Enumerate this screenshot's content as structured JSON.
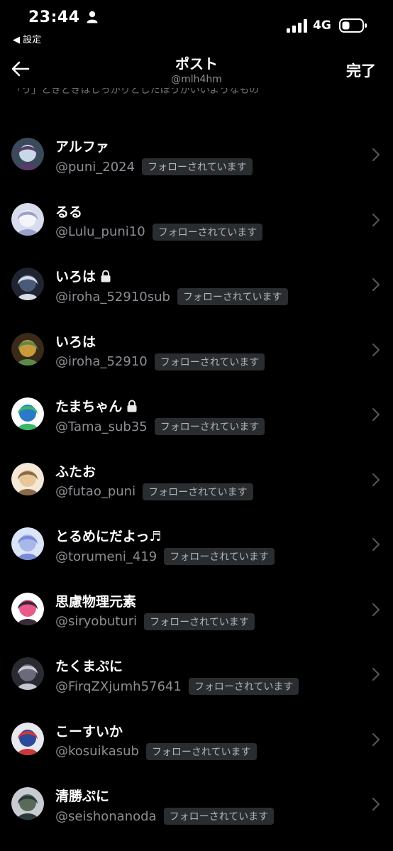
{
  "status_bar": {
    "time": "23:44",
    "back_app": "◀ 設定",
    "network": "4G"
  },
  "nav": {
    "title": "ポスト",
    "subtitle": "@mlh4hm",
    "done_label": "完了"
  },
  "cut_text": "「う」ときどきはしっかりとしたほうがいいようなもの",
  "badge_label": "フォローされています",
  "users": [
    {
      "name": "アルファ",
      "handle": "@puni_2024",
      "locked": false,
      "avatar_colors": [
        "#3a4a5a",
        "#c8d8e8",
        "#5a3a6a"
      ]
    },
    {
      "name": "るる",
      "handle": "@Lulu_puni10",
      "locked": false,
      "avatar_colors": [
        "#d8dcec",
        "#f4f4fa",
        "#9aa0c8"
      ]
    },
    {
      "name": "いろは",
      "handle": "@iroha_52910sub",
      "locked": true,
      "avatar_colors": [
        "#1e2430",
        "#4a5a7a",
        "#d8dce8"
      ]
    },
    {
      "name": "いろは",
      "handle": "@iroha_52910",
      "locked": false,
      "avatar_colors": [
        "#3a2a1a",
        "#c89a3a",
        "#5a8a4a"
      ]
    },
    {
      "name": "たまちゃん",
      "handle": "@Tama_sub35",
      "locked": true,
      "avatar_colors": [
        "#ffffff",
        "#2a7ac8",
        "#3ab868"
      ]
    },
    {
      "name": "ふたお",
      "handle": "@futao_puni",
      "locked": false,
      "avatar_colors": [
        "#f4e8d8",
        "#e8c898",
        "#8a6a4a"
      ]
    },
    {
      "name": "とるめにだよっ♬",
      "handle": "@torumeni_419",
      "locked": false,
      "avatar_colors": [
        "#dce4f8",
        "#a8b8e8",
        "#7a8ad8"
      ]
    },
    {
      "name": "思慮物理元素",
      "handle": "@siryobuturi",
      "locked": false,
      "avatar_colors": [
        "#ffffff",
        "#e85a8a",
        "#3a2a3a"
      ]
    },
    {
      "name": "たくまぷに",
      "handle": "@FirqZXjumh57641",
      "locked": false,
      "avatar_colors": [
        "#2a2a32",
        "#6a6a7a",
        "#c8c8d4"
      ]
    },
    {
      "name": "こーすいか",
      "handle": "@kosuikasub",
      "locked": false,
      "avatar_colors": [
        "#e8e8f0",
        "#2a4a9a",
        "#c83a3a"
      ]
    },
    {
      "name": "清勝ぷに",
      "handle": "@seishonanoda",
      "locked": false,
      "avatar_colors": [
        "#c8ccd0",
        "#5a6a5a",
        "#2a3a3a"
      ]
    }
  ]
}
